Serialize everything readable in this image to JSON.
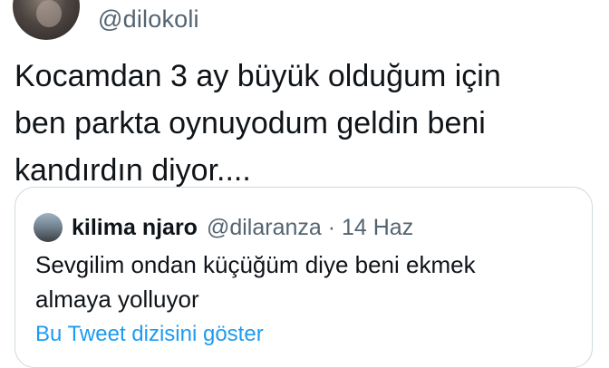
{
  "tweet": {
    "handle": "@dilokoli",
    "text_lines": [
      "Kocamdan 3 ay büyük olduğum için",
      "ben parkta oynuyodum geldin beni",
      "kandırdın diyor...."
    ]
  },
  "quoted_tweet": {
    "name": "kilima njaro",
    "meta": "@dilaranza · 14 Haz",
    "text_lines": [
      "Sevgilim ondan küçüğüm diye beni ekmek",
      "almaya yolluyor"
    ],
    "thread_link": "Bu Tweet dizisini göster"
  }
}
